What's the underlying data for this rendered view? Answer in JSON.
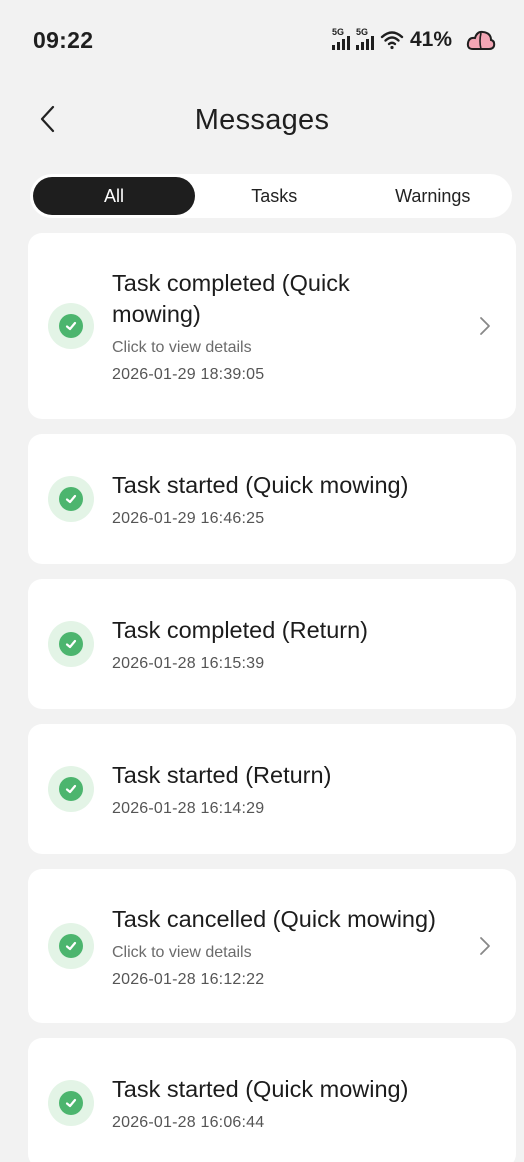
{
  "status": {
    "time": "09:22",
    "network1": "5G",
    "network2": "5G",
    "battery": "41%"
  },
  "header": {
    "title": "Messages"
  },
  "tabs": [
    {
      "label": "All"
    },
    {
      "label": "Tasks"
    },
    {
      "label": "Warnings"
    }
  ],
  "messages": [
    {
      "title": "Task completed (Quick mowing)",
      "hint": "Click to view details",
      "time": "2026-01-29 18:39:05"
    },
    {
      "title": "Task started (Quick mowing)",
      "hint": "",
      "time": "2026-01-29 16:46:25"
    },
    {
      "title": "Task completed (Return)",
      "hint": "",
      "time": "2026-01-28 16:15:39"
    },
    {
      "title": "Task started (Return)",
      "hint": "",
      "time": "2026-01-28 16:14:29"
    },
    {
      "title": "Task cancelled (Quick mowing)",
      "hint": "Click to view details",
      "time": "2026-01-28 16:12:22"
    },
    {
      "title": "Task started (Quick mowing)",
      "hint": "",
      "time": "2026-01-28 16:06:44"
    }
  ],
  "colors": {
    "success_icon": "#4cb56e",
    "success_icon_bg": "#e3f4e6",
    "active_tab": "#1e1e1e"
  }
}
